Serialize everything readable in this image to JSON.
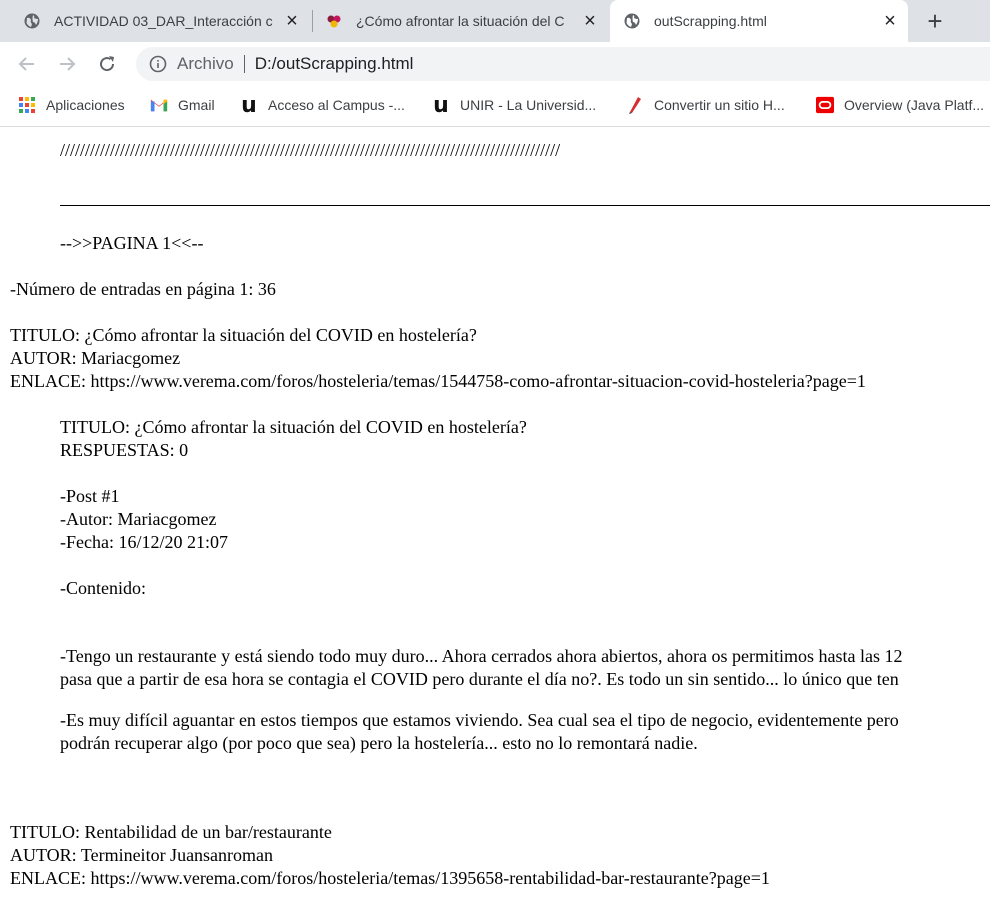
{
  "tabs": [
    {
      "title": "ACTIVIDAD 03_DAR_Interacción c",
      "favicon": "globe-icon"
    },
    {
      "title": "¿Cómo afrontar la situación del C",
      "favicon": "verema-icon"
    },
    {
      "title": "outScrapping.html",
      "favicon": "globe-icon"
    }
  ],
  "toolbar": {
    "scheme": "Archivo",
    "url": "D:/outScrapping.html"
  },
  "bookmarks": [
    {
      "label": "Aplicaciones",
      "icon": "apps-grid-icon"
    },
    {
      "label": "Gmail",
      "icon": "gmail-icon"
    },
    {
      "label": "Acceso al Campus -...",
      "icon": "unir-icon"
    },
    {
      "label": "UNIR - La Universid...",
      "icon": "unir-icon"
    },
    {
      "label": "Convertir un sitio H...",
      "icon": "pen-icon"
    },
    {
      "label": "Overview (Java Platf...",
      "icon": "oracle-icon"
    }
  ],
  "page": {
    "slashes": "////////////////////////////////////////////////////////////////////////////////////////////////////",
    "pagina": "-->>PAGINA 1<<--",
    "entradas": "-Número de entradas en página 1: 36",
    "entry1": {
      "titulo": "TITULO: ¿Cómo afrontar la situación del COVID en hostelería?",
      "autor": "AUTOR: Mariacgomez",
      "enlace": "ENLACE: https://www.verema.com/foros/hosteleria/temas/1544758-como-afrontar-situacion-covid-hosteleria?page=1"
    },
    "thread": {
      "titulo": "TITULO: ¿Cómo afrontar la situación del COVID en hostelería?",
      "respuestas": "RESPUESTAS: 0",
      "post": "-Post #1",
      "autor": "-Autor: Mariacgomez",
      "fecha": "-Fecha: 16/12/20 21:07",
      "contenido_label": "-Contenido:",
      "p1_l1": "-Tengo un restaurante y está siendo todo muy duro... Ahora cerrados ahora abiertos, ahora os permitimos hasta las 12",
      "p1_l2": "pasa que a partir de esa hora se contagia el COVID pero durante el día no?. Es todo un sin sentido... lo único que ten",
      "p2_l1": "-Es muy difícil aguantar en estos tiempos que estamos viviendo. Sea cual sea el tipo de negocio, evidentemente pero",
      "p2_l2": "podrán recuperar algo (por poco que sea) pero la hostelería... esto no lo remontará nadie."
    },
    "entry2": {
      "titulo": "TITULO: Rentabilidad de un bar/restaurante",
      "autor": "AUTOR: Termineitor Juansanroman",
      "enlace": "ENLACE: https://www.verema.com/foros/hosteleria/temas/1395658-rentabilidad-bar-restaurante?page=1"
    }
  }
}
